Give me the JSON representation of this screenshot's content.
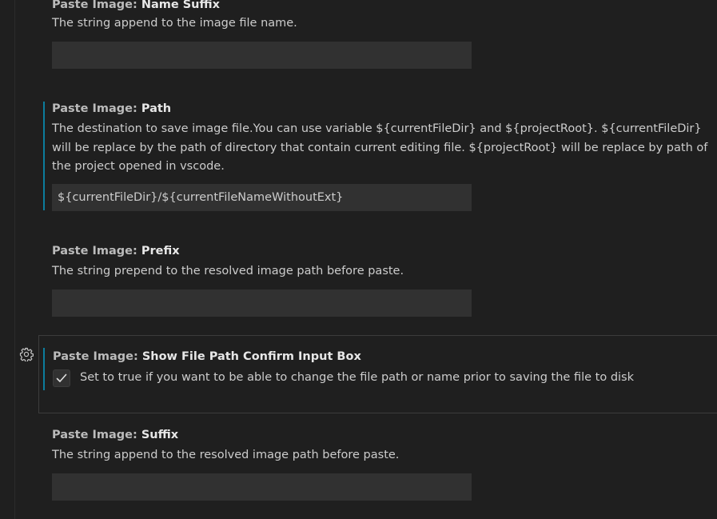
{
  "settings": [
    {
      "id": "name-suffix",
      "category": "Paste Image: ",
      "key": "Name Suffix",
      "description": "The string append to the image file name.",
      "value": ""
    },
    {
      "id": "path",
      "category": "Paste Image: ",
      "key": "Path",
      "description": "The destination to save image file.You can use variable ${currentFileDir} and ${projectRoot}. ${currentFileDir} will be replace by the path of directory that contain current editing file. ${projectRoot} will be replace by path of the project opened in vscode.",
      "value": "${currentFileDir}/${currentFileNameWithoutExt}"
    },
    {
      "id": "prefix",
      "category": "Paste Image: ",
      "key": "Prefix",
      "description": "The string prepend to the resolved image path before paste.",
      "value": ""
    },
    {
      "id": "show-file-path-confirm-input-box",
      "category": "Paste Image: ",
      "key": "Show File Path Confirm Input Box",
      "description": "Set to true if you want to be able to change the file path or name prior to saving the file to disk",
      "checked": true
    },
    {
      "id": "suffix",
      "category": "Paste Image: ",
      "key": "Suffix",
      "description": "The string append to the resolved image path before paste.",
      "value": ""
    }
  ],
  "icons": {
    "gear": "gear-icon",
    "check": "check-icon"
  },
  "colors": {
    "modified_indicator": "#0c7d9d",
    "input_background": "#313131",
    "editor_background": "#1f1f1f"
  }
}
